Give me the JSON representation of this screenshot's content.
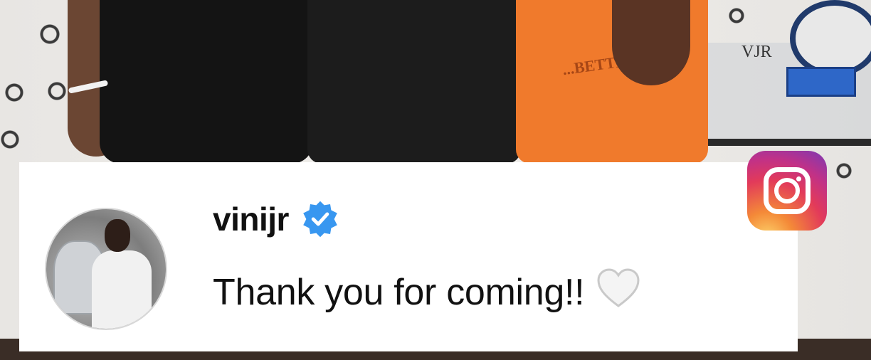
{
  "comment": {
    "username": "vinijr",
    "verified": true,
    "text": "Thank you for coming!!",
    "reaction_icon": "white-heart-icon"
  },
  "background": {
    "shirt_text": "...BETTER",
    "wall_text": "VJR"
  },
  "colors": {
    "verified_blue": "#3897f0",
    "card_background": "#ffffff",
    "instagram_gradient": [
      "#fdd46b",
      "#f48a38",
      "#e23a5a",
      "#c13187",
      "#7a3ab5"
    ]
  }
}
